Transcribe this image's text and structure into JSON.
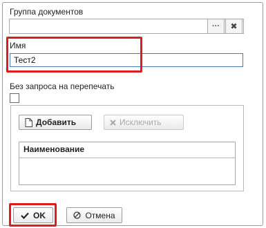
{
  "form": {
    "group_label": "Группа документов",
    "group_value": "",
    "group_select_label": "···",
    "group_clear_label": "✖",
    "name_label": "Имя",
    "name_value": "Тест2",
    "no_prompt_label": "Без запроса на перепечать",
    "no_prompt_checked": false
  },
  "toolbar": {
    "add_label": "Добавить",
    "exclude_label": "Исключить"
  },
  "grid": {
    "columns": [
      "Наименование"
    ],
    "rows": []
  },
  "footer": {
    "ok_label": "OK",
    "cancel_label": "Отмена"
  },
  "colors": {
    "highlight": "#e01b1b",
    "input_focus_border": "#4a78b8",
    "disabled_text": "#a8a8a8"
  }
}
